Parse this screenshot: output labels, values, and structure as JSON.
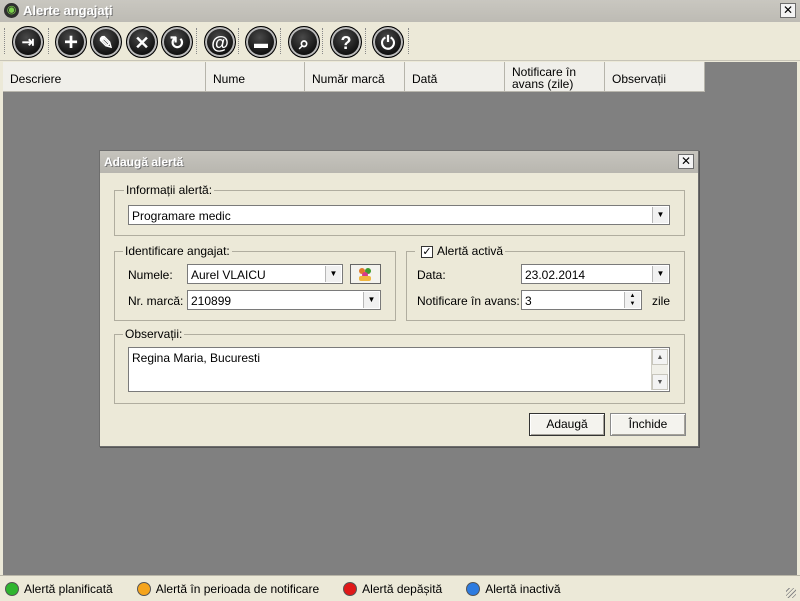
{
  "window": {
    "title": "Alerte angajați",
    "close_label": "✕"
  },
  "toolbar": {
    "buttons": [
      {
        "name": "exit",
        "glyph": "⇥"
      },
      {
        "name": "add",
        "glyph": "+"
      },
      {
        "name": "edit",
        "glyph": "✎"
      },
      {
        "name": "delete",
        "glyph": "✕"
      },
      {
        "name": "refresh",
        "glyph": "↻"
      },
      {
        "name": "email",
        "glyph": "@"
      },
      {
        "name": "print",
        "glyph": "▬"
      },
      {
        "name": "search",
        "glyph": "⌕"
      },
      {
        "name": "help",
        "glyph": "?"
      },
      {
        "name": "power",
        "glyph": "⏻"
      }
    ]
  },
  "grid": {
    "columns": [
      "Descriere",
      "Nume",
      "Număr marcă",
      "Dată",
      "Notificare în avans (zile)",
      "Observații"
    ]
  },
  "dialog": {
    "title": "Adaugă alertă",
    "close_label": "✕",
    "info_group": {
      "legend": "Informații alertă:",
      "value": "Programare medic"
    },
    "employee_group": {
      "legend": "Identificare angajat:",
      "name_label": "Numele:",
      "name_value": "Aurel VLAICU",
      "id_label": "Nr. marcă:",
      "id_value": "210899"
    },
    "alert_group": {
      "active_label": "Alertă activă",
      "active_checked": true,
      "date_label": "Data:",
      "date_value": "23.02.2014",
      "notice_label": "Notificare în avans:",
      "notice_value": "3",
      "notice_unit": "zile"
    },
    "notes_group": {
      "legend": "Observații:",
      "value": "Regina Maria, Bucuresti"
    },
    "add_button": "Adaugă",
    "close_button": "Închide"
  },
  "statusbar": {
    "legend": [
      {
        "label": "Alertă planificată",
        "color": "#2fb52f"
      },
      {
        "label": "Alertă în perioada de notificare",
        "color": "#f5a41c"
      },
      {
        "label": "Alertă depășită",
        "color": "#e01818"
      },
      {
        "label": "Alertă inactivă",
        "color": "#2d7be0"
      }
    ]
  }
}
